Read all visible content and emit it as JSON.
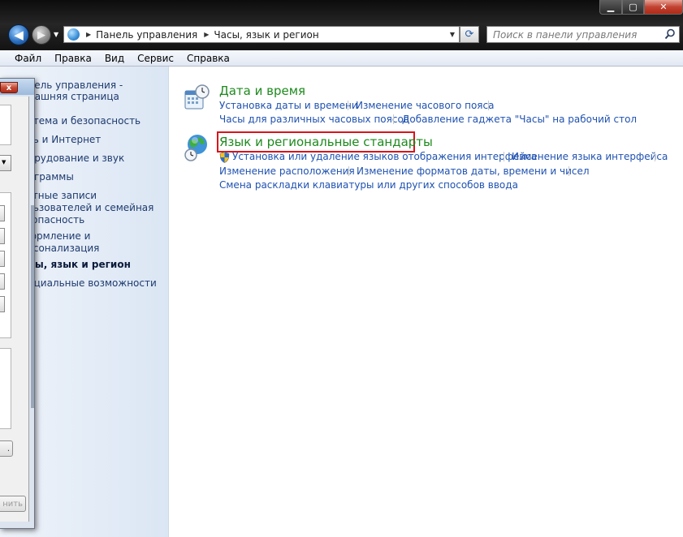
{
  "window": {
    "minimize": "▁",
    "maximize": "▢",
    "close": "✕"
  },
  "navigation": {
    "breadcrumbs": [
      "Панель управления",
      "Часы, язык и регион"
    ]
  },
  "search": {
    "placeholder": "Поиск в панели управления"
  },
  "menu": [
    "Файл",
    "Правка",
    "Вид",
    "Сервис",
    "Справка"
  ],
  "left_nav": {
    "items": [
      {
        "label": "Панель управления -"
      },
      {
        "label": "домашняя страница"
      },
      {
        "label": "Система и безопасность"
      },
      {
        "label": "Сеть и Интернет"
      },
      {
        "label": "Оборудование и звук"
      },
      {
        "label": "Программы"
      },
      {
        "label": "Учетные записи"
      },
      {
        "label": "пользователей и семейная"
      },
      {
        "label": "безопасность"
      },
      {
        "label": "Оформление и"
      },
      {
        "label": "персонализация"
      },
      {
        "label": "Часы, язык и регион"
      },
      {
        "label": "Специальные возможности"
      }
    ]
  },
  "categories": [
    {
      "title": "Дата и время",
      "icon": "calendar-clock-icon",
      "tasks": [
        "Установка даты и времени",
        "Изменение часового пояса",
        "Часы для различных часовых поясов",
        "Добавление гаджета \"Часы\" на рабочий стол"
      ]
    },
    {
      "title": "Язык и региональные стандарты",
      "icon": "globe-clock-icon",
      "tasks": [
        "Установка или удаление языков отображения интерфейса",
        "Изменение языка интерфейса",
        "Изменение расположения",
        "Изменение форматов даты, времени и чисел",
        "Смена раскладки клавиатуры или других способов ввода"
      ]
    }
  ],
  "dialog": {
    "close": "x",
    "button1": ".",
    "button2": "нить"
  },
  "colors": {
    "category_title": "#1e8a1e",
    "task_link": "#1f52b1",
    "highlight": "#d9141b"
  }
}
